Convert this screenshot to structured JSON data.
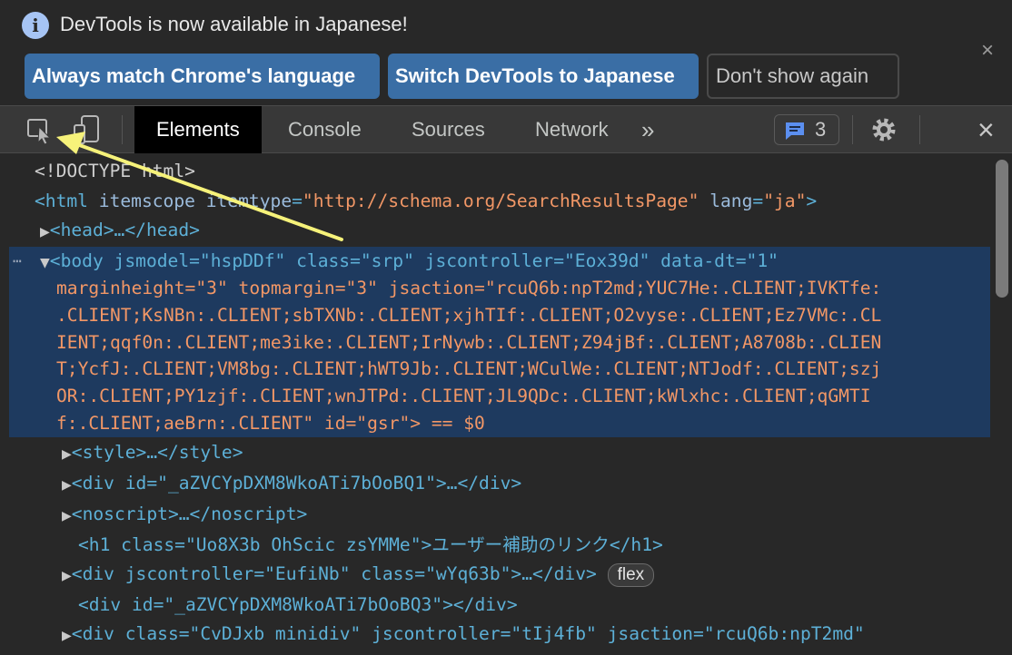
{
  "notice": {
    "icon": "info-icon",
    "text": "DevTools is now available in Japanese!",
    "buttons": [
      "Always match Chrome's language",
      "Switch DevTools to Japanese",
      "Don't show again"
    ],
    "close": "×"
  },
  "toolbar": {
    "tabs": [
      "Elements",
      "Console",
      "Sources",
      "Network"
    ],
    "active_tab": "Elements",
    "more": "»",
    "issues_count": "3",
    "close": "×"
  },
  "dom": {
    "doctype": "<!DOCTYPE html>",
    "html_open": "<html",
    "html_attrs": [
      {
        "name": "itemscope",
        "value": null
      },
      {
        "name": "itemtype",
        "value": "http://schema.org/SearchResultsPage"
      },
      {
        "name": "lang",
        "value": "ja"
      }
    ],
    "head": "<head>…</head>",
    "body_lines": [
      "<body jsmodel=\"hspDDf\" class=\"srp\" jscontroller=\"Eox39d\" data-dt=\"1\"",
      "marginheight=\"3\" topmargin=\"3\" jsaction=\"rcuQ6b:npT2md;YUC7He:.CLIENT;IVKTfe:",
      ".CLIENT;KsNBn:.CLIENT;sbTXNb:.CLIENT;xjhTIf:.CLIENT;O2vyse:.CLIENT;Ez7VMc:.CL",
      "IENT;qqf0n:.CLIENT;me3ike:.CLIENT;IrNywb:.CLIENT;Z94jBf:.CLIENT;A8708b:.CLIEN",
      "T;YcfJ:.CLIENT;VM8bg:.CLIENT;hWT9Jb:.CLIENT;WCulWe:.CLIENT;NTJodf:.CLIENT;szj",
      "OR:.CLIENT;PY1zjf:.CLIENT;wnJTPd:.CLIENT;JL9QDc:.CLIENT;kWlxhc:.CLIENT;qGMTI",
      "f:.CLIENT;aeBrn:.CLIENT\" id=\"gsr\"> == $0"
    ],
    "children": [
      "<style>…</style>",
      "<div id=\"_aZVCYpDXM8WkoATi7bOoBQ1\">…</div>",
      "<noscript>…</noscript>",
      "<h1 class=\"Uo8X3b OhScic zsYMMe\">ユーザー補助のリンク</h1>",
      "<div jscontroller=\"EufiNb\" class=\"wYq63b\">…</div>",
      "<div id=\"_aZVCYpDXM8WkoATi7bOoBQ3\"></div>",
      "<div class=\"CvDJxb minidiv\" jscontroller=\"tIj4fb\" jsaction=\"rcuQ6b:npT2md\""
    ],
    "flex_badge": "flex"
  },
  "colors": {
    "tag": "#5db0d7",
    "attr": "#9bbbdc",
    "value": "#f29766",
    "selected_bg": "#1e3a5f",
    "primary_button": "#3a6ea5",
    "annotation_arrow": "#f6f27a"
  }
}
